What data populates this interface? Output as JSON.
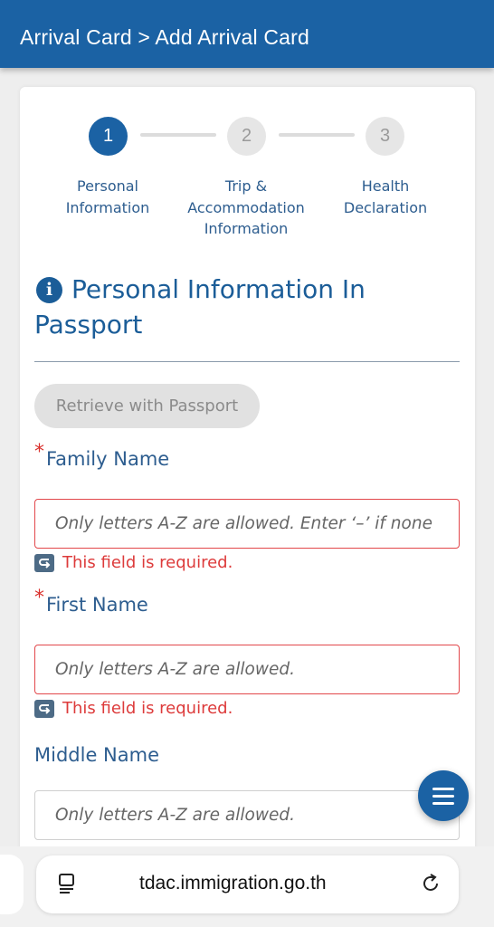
{
  "header": {
    "breadcrumb": "Arrival Card > Add Arrival Card"
  },
  "steps": [
    {
      "number": "1",
      "label_lines": [
        "Personal",
        "Information"
      ],
      "active": true
    },
    {
      "number": "2",
      "label_lines": [
        "Trip &",
        "Accommodation",
        "Information"
      ],
      "active": false
    },
    {
      "number": "3",
      "label_lines": [
        "Health",
        "Declaration"
      ],
      "active": false
    }
  ],
  "section": {
    "title_line1": "Personal Information In",
    "title_line2": "Passport",
    "icon": "info-icon"
  },
  "retrieve_button": {
    "label": "Retrieve with Passport"
  },
  "fields": {
    "family_name": {
      "required_mark": "*",
      "label": "Family Name",
      "placeholder": "Only letters A-Z are allowed. Enter ‘–’ if none",
      "error": "This field is required."
    },
    "first_name": {
      "required_mark": "*",
      "label": "First Name",
      "placeholder": "Only letters A-Z are allowed.",
      "error": "This field is required."
    },
    "middle_name": {
      "label": "Middle Name",
      "placeholder": "Only letters A-Z are allowed."
    }
  },
  "fab": {
    "icon": "hamburger-menu-icon"
  },
  "browser": {
    "url": "tdac.immigration.go.th",
    "reader_icon": "page-reader-icon",
    "reload_icon": "reload-icon"
  },
  "colors": {
    "brand_blue": "#1b62a4",
    "label_blue": "#2d5d8f",
    "error_red": "#dd3b3b"
  }
}
